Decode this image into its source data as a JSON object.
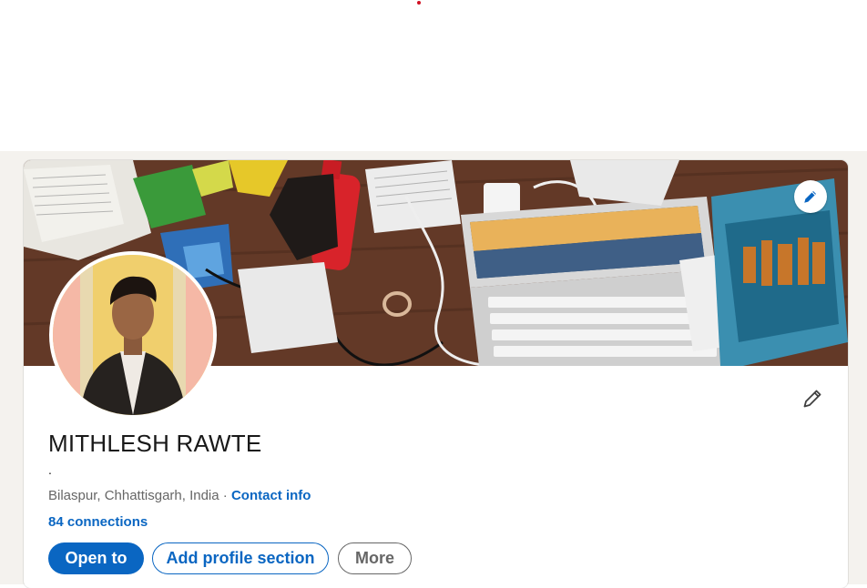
{
  "profile": {
    "name": "MITHLESH RAWTE",
    "headline": ".",
    "location": "Bilaspur, Chhattisgarh, India",
    "separator": " · ",
    "contact_info_label": "Contact info",
    "connections_label": "84 connections"
  },
  "actions": {
    "open_to_label": "Open to",
    "add_section_label": "Add profile section",
    "more_label": "More"
  },
  "icons": {
    "banner_edit": "pencil-icon",
    "intro_edit": "pencil-icon"
  },
  "colors": {
    "brand_blue": "#0a66c2",
    "secondary_text": "#666666",
    "page_background": "#f4f2ee"
  }
}
